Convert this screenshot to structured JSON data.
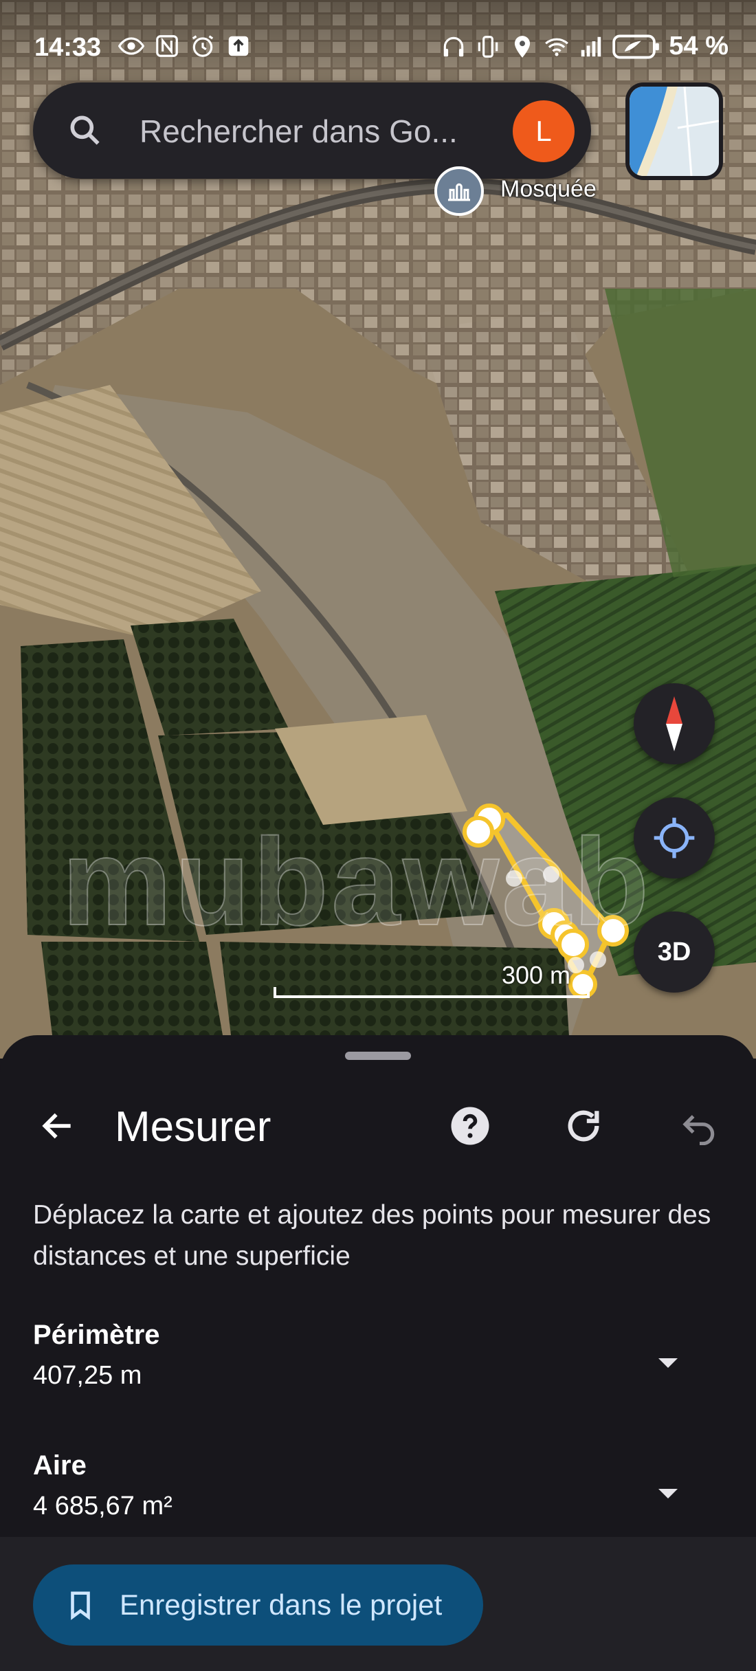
{
  "status_bar": {
    "time": "14:33",
    "battery": "54 %",
    "left_icons": [
      "eye-icon",
      "nfc-icon",
      "alarm-icon",
      "upload-icon"
    ],
    "right_icons": [
      "headphones-icon",
      "vibrate-icon",
      "location-icon",
      "wifi-icon",
      "signal-icon",
      "battery-icon"
    ]
  },
  "search": {
    "placeholder": "Rechercher dans Go...",
    "avatar_letter": "L",
    "avatar_color": "#ef5a1b"
  },
  "map": {
    "poi_label": "Mosquée",
    "scale_label": "300 m",
    "watermark": "mubawab",
    "measure_color": "#f5c42c",
    "buttons": {
      "three_d": "3D"
    }
  },
  "sheet": {
    "title": "Mesurer",
    "instructions": "Déplacez la carte et ajoutez des points pour mesurer des distances et une superficie",
    "perimeter": {
      "label": "Périmètre",
      "value": "407,25 m"
    },
    "area": {
      "label": "Aire",
      "value": "4 685,67 m²"
    },
    "save_button": "Enregistrer dans le projet",
    "accent_color": "#0d4f7a"
  }
}
